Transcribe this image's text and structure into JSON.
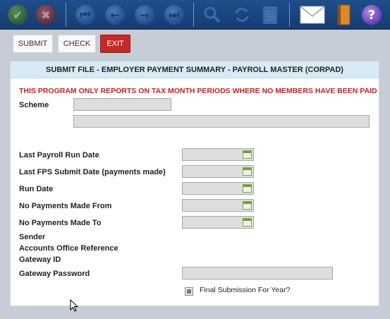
{
  "toolbar": {
    "items": [
      "check-icon",
      "cancel-icon",
      "first-icon",
      "prev-icon",
      "next-icon",
      "last-icon",
      "search-icon",
      "refresh-icon",
      "notepad-icon",
      "mail-icon",
      "book-icon",
      "help-icon"
    ]
  },
  "actions": {
    "submit_label": "SUBMIT",
    "check_label": "CHECK",
    "exit_label": "EXIT"
  },
  "panel": {
    "title": "SUBMIT FILE - EMPLOYER PAYMENT SUMMARY - PAYROLL MASTER (CORPAD)",
    "warning": "THIS PROGRAM ONLY REPORTS ON TAX MONTH PERIODS WHERE NO MEMBERS HAVE BEEN PAID",
    "scheme_label": "Scheme",
    "scheme_code": "",
    "scheme_name": "",
    "last_payroll_run_label": "Last Payroll Run Date",
    "last_payroll_run_value": "",
    "last_fps_label": "Last FPS Submit Date (payments made)",
    "last_fps_value": "",
    "run_date_label": "Run Date",
    "run_date_value": "",
    "no_pay_from_label": "No Payments Made From",
    "no_pay_from_value": "",
    "no_pay_to_label": "No Payments Made To",
    "no_pay_to_value": "",
    "sender_label": "Sender",
    "accounts_ref_label": "Accounts Office Reference",
    "gateway_id_label": "Gateway ID",
    "gateway_pw_label": "Gateway Password",
    "gateway_pw_value": "",
    "final_submission_label": "Final Submission For Year?"
  },
  "colors": {
    "toolbar_bg": "#1f4e8c",
    "header_bg": "#d6ebf7",
    "warning": "#d01f1f",
    "exit_button": "#c42a2a"
  }
}
